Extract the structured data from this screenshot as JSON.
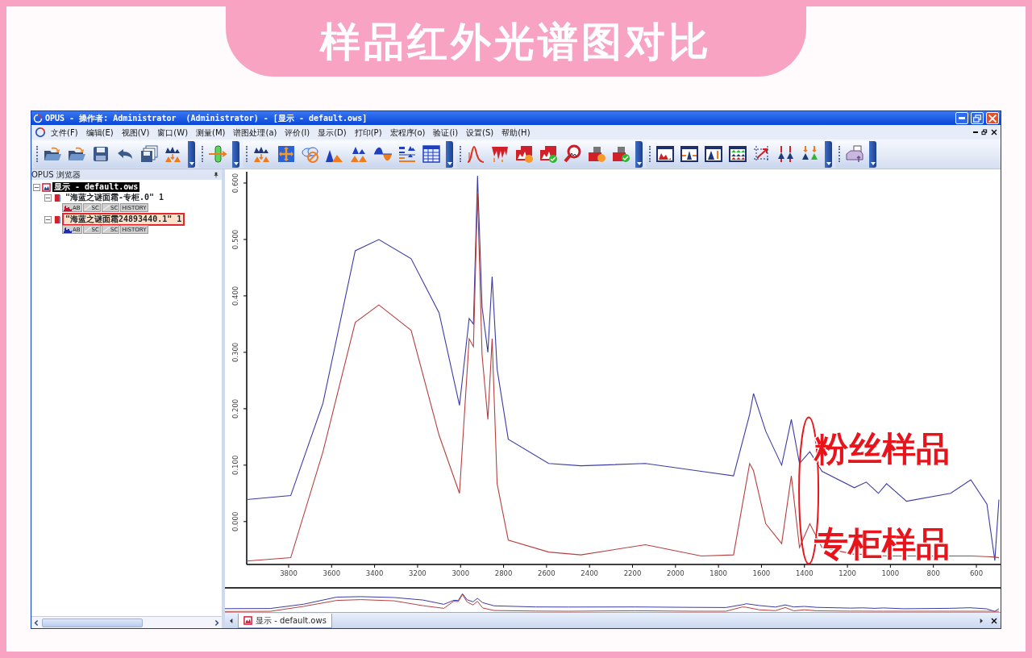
{
  "banner": {
    "title": "样品红外光谱图对比"
  },
  "window": {
    "title": "OPUS - 操作者: Administrator  (Administrator) - [显示 - default.ows]"
  },
  "menu": [
    "文件(F)",
    "编辑(E)",
    "视图(V)",
    "窗口(W)",
    "测量(M)",
    "谱图处理(a)",
    "评价(I)",
    "显示(D)",
    "打印(P)",
    "宏程序(o)",
    "验证(i)",
    "设置(S)",
    "帮助(H)"
  ],
  "browser": {
    "title": "OPUS 浏览器",
    "tree": [
      {
        "label": "显示 - default.ows",
        "selected": true,
        "highlighted": false,
        "expanded": true,
        "children": [
          {
            "label": "\"海蓝之谜面霜-专柜.0\" 1",
            "selected": false,
            "highlighted": false,
            "expanded": true,
            "color": "#c8102e",
            "blocks": [
              "AB",
              "SC",
              "SC",
              "HISTORY"
            ]
          },
          {
            "label": "\"海蓝之谜面霜24893440.1\" 1",
            "selected": false,
            "highlighted": true,
            "expanded": true,
            "color": "#1f2aa8",
            "blocks": [
              "AB",
              "SC",
              "SC",
              "HISTORY"
            ]
          }
        ]
      }
    ]
  },
  "chart_data": {
    "type": "line",
    "x": [
      3995,
      3790,
      3640,
      3490,
      3380,
      3230,
      3100,
      3005,
      2960,
      2940,
      2921,
      2900,
      2873,
      2853,
      2830,
      2778,
      2590,
      2440,
      2140,
      1880,
      1730,
      1655,
      1637,
      1580,
      1506,
      1461,
      1423,
      1375,
      1318,
      1168,
      1112,
      1056,
      1018,
      925,
      720,
      626,
      551,
      514,
      495
    ],
    "series": [
      {
        "color": "#3b3ba6",
        "values": [
          0.039,
          0.046,
          0.21,
          0.48,
          0.5,
          0.466,
          0.37,
          0.206,
          0.36,
          0.35,
          0.613,
          0.38,
          0.3,
          0.434,
          0.27,
          0.146,
          0.103,
          0.099,
          0.103,
          0.089,
          0.081,
          0.19,
          0.227,
          0.16,
          0.1,
          0.181,
          0.103,
          0.124,
          0.089,
          0.06,
          0.07,
          0.05,
          0.067,
          0.036,
          0.05,
          0.074,
          0.031,
          -0.069,
          0.039
        ]
      },
      {
        "color": "#b5403f",
        "values": [
          -0.07,
          -0.064,
          0.124,
          0.353,
          0.384,
          0.339,
          0.153,
          0.05,
          0.324,
          0.31,
          0.581,
          0.296,
          0.181,
          0.324,
          0.067,
          -0.033,
          -0.054,
          -0.059,
          -0.041,
          -0.061,
          -0.059,
          0.103,
          0.09,
          -0.004,
          -0.039,
          0.081,
          -0.046,
          -0.004,
          -0.046,
          -0.058,
          -0.058,
          -0.06,
          -0.061,
          -0.061,
          -0.061,
          -0.061,
          -0.062,
          -0.063,
          -0.064
        ]
      }
    ],
    "xlim": [
      3995,
      495
    ],
    "ylim": [
      -0.076,
      0.62
    ],
    "xticks": [
      3800,
      3600,
      3400,
      3200,
      3000,
      2800,
      2600,
      2400,
      2200,
      2000,
      1800,
      1600,
      1400,
      1200,
      1000,
      800,
      600
    ],
    "yticks": [
      {
        "value": 0,
        "label": "0.000"
      },
      {
        "value": 0.1,
        "label": "0.100"
      },
      {
        "value": 0.2,
        "label": "0.200"
      },
      {
        "value": 0.3,
        "label": "0.300"
      },
      {
        "value": 0.4,
        "label": "0.400"
      },
      {
        "value": 0.5,
        "label": "0.500"
      },
      {
        "value": 0.6,
        "label": "0.600"
      }
    ],
    "annotations": [
      "粉丝样品",
      "专柜样品"
    ]
  },
  "tabs": [
    {
      "label": "显示 - default.ows",
      "selected": true
    }
  ]
}
